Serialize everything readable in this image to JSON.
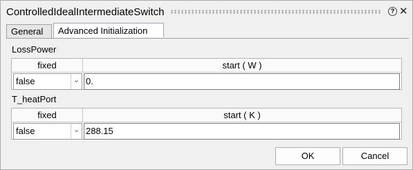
{
  "window": {
    "title": "ControlledIdealIntermediateSwitch",
    "help_label": "?",
    "close_label": "✕"
  },
  "tabs": [
    {
      "label": "General",
      "active": false
    },
    {
      "label": "Advanced Initialization",
      "active": true
    }
  ],
  "sections": [
    {
      "label": "LossPower",
      "columns": {
        "fixed": "fixed",
        "start": "start ( W )"
      },
      "fixed_value": "false",
      "start_value": "0."
    },
    {
      "label": "T_heatPort",
      "columns": {
        "fixed": "fixed",
        "start": "start ( K )"
      },
      "fixed_value": "false",
      "start_value": "288.15"
    }
  ],
  "buttons": {
    "ok": "OK",
    "cancel": "Cancel"
  }
}
